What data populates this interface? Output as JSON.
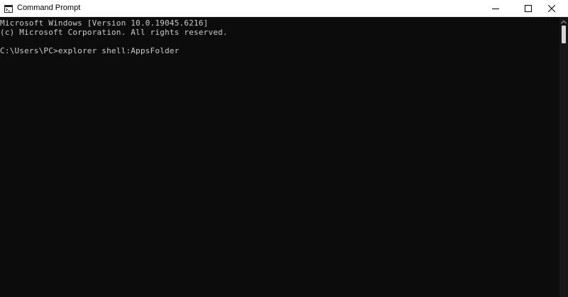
{
  "window": {
    "title": "Command Prompt",
    "icon": "cmd-icon"
  },
  "titlebar": {
    "buttons": [
      {
        "name": "minimize",
        "icon": "minimize-icon"
      },
      {
        "name": "maximize",
        "icon": "maximize-icon"
      },
      {
        "name": "close",
        "icon": "close-icon"
      }
    ]
  },
  "console": {
    "lines": [
      "Microsoft Windows [Version 10.0.19045.6216]",
      "(c) Microsoft Corporation. All rights reserved.",
      "C:\\Users\\PC>explorer shell:AppsFolder"
    ],
    "text_color": "#cccccc",
    "background": "#0c0c0c"
  },
  "scrollbar": {
    "icon": "scroll-up-arrow-icon"
  }
}
